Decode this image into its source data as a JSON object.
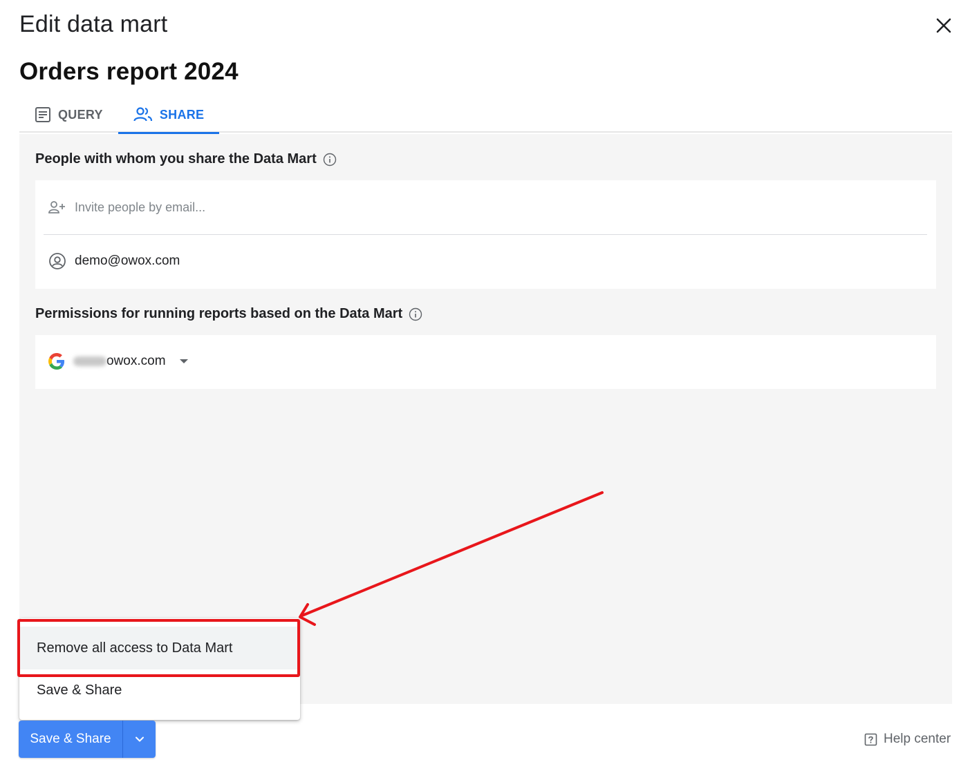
{
  "dialog": {
    "title": "Edit data mart"
  },
  "report": {
    "title": "Orders report 2024"
  },
  "tabs": [
    {
      "label": "QUERY",
      "icon": "document-icon",
      "active": false
    },
    {
      "label": "SHARE",
      "icon": "people-icon",
      "active": true
    }
  ],
  "share": {
    "people_label": "People with whom you share the Data Mart",
    "invite_placeholder": "Invite people by email...",
    "members": [
      {
        "email": "demo@owox.com",
        "icon": "account-circle-icon"
      }
    ],
    "permissions_label": "Permissions for running reports based on the Data Mart",
    "account": {
      "provider_icon": "google-g-icon",
      "email_visible_part": "owox.com"
    }
  },
  "menu": {
    "items": [
      "Remove all access to Data Mart",
      "Save & Share"
    ],
    "highlighted_item": "Remove all access to Data Mart"
  },
  "footer": {
    "primary_button": "Save & Share",
    "help_link": "Help center"
  },
  "colors": {
    "accent": "#1a73e8",
    "button": "#4285f4",
    "annotation": "#e8161b",
    "panel_background": "#f5f5f5"
  }
}
